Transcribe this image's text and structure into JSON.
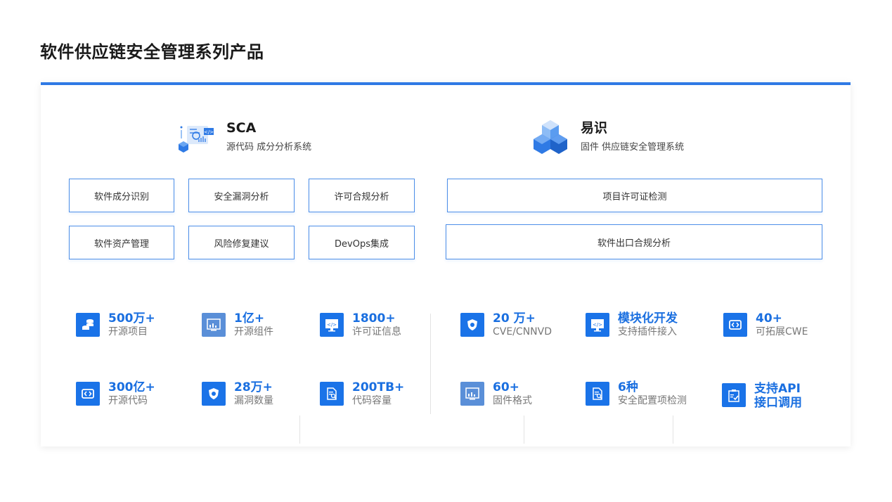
{
  "page": {
    "title": "软件供应链安全管理系列产品"
  },
  "products": [
    {
      "name": "SCA",
      "subtitle": "源代码 成分分析系统",
      "icon": "sca-code-analysis-icon"
    },
    {
      "name": "易识",
      "subtitle": "固件 供应链安全管理系统",
      "icon": "stacked-cubes-icon"
    }
  ],
  "sca_features": [
    "软件成分识别",
    "安全漏洞分析",
    "许可合规分析",
    "软件资产管理",
    "风险修复建议",
    "DevOps集成"
  ],
  "yishi_features": [
    "项目许可证检测",
    "软件出口合规分析"
  ],
  "sca_stats": [
    {
      "value": "500万+",
      "label": "开源项目",
      "icon": "database-coins-icon"
    },
    {
      "value": "1亿+",
      "label": "开源组件",
      "icon": "monitor-chart-icon"
    },
    {
      "value": "1800+",
      "label": "许可证信息",
      "icon": "code-monitor-icon"
    },
    {
      "value": "300亿+",
      "label": "开源代码",
      "icon": "code-brackets-icon"
    },
    {
      "value": "28万+",
      "label": "漏洞数量",
      "icon": "shield-bug-icon"
    },
    {
      "value": "200TB+",
      "label": "代码容量",
      "icon": "document-search-icon"
    }
  ],
  "yishi_stats": [
    {
      "value": "20 万+",
      "label": "CVE/CNNVD",
      "icon": "shield-bug-icon"
    },
    {
      "value": "模块化开发",
      "label": "支持插件接入",
      "icon": "code-monitor-icon"
    },
    {
      "value": "40+",
      "label": "可拓展CWE",
      "icon": "code-brackets-icon"
    },
    {
      "value": "60+",
      "label": "固件格式",
      "icon": "monitor-chart-icon"
    },
    {
      "value": "6种",
      "label": "安全配置项检测",
      "icon": "document-search-icon"
    },
    {
      "value": "支持API",
      "value2": "接口调用",
      "icon": "clipboard-check-icon"
    }
  ],
  "colors": {
    "accent": "#2f7ae5",
    "icon_bg": "#1a73e8",
    "value_text": "#1a6fe0"
  }
}
